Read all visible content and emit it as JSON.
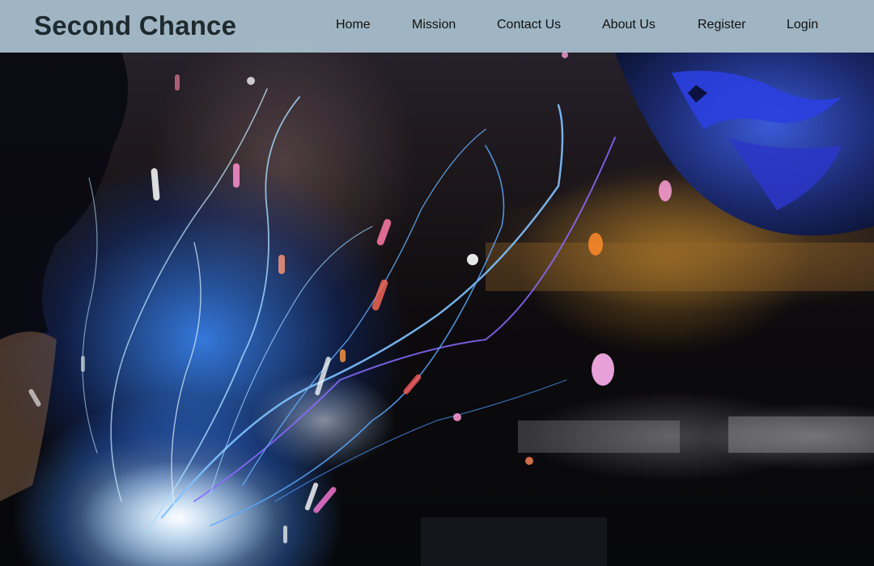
{
  "brand": {
    "name": "Second Chance"
  },
  "nav": {
    "items": [
      {
        "label": "Home"
      },
      {
        "label": "Mission"
      },
      {
        "label": "Contact Us"
      },
      {
        "label": "About Us"
      },
      {
        "label": "Register"
      },
      {
        "label": "Login"
      }
    ]
  },
  "hero": {
    "image_subject": "welding-sparks-photo"
  },
  "colors": {
    "navbar_background": "#bad6e4",
    "brand_text": "#1f2a2e",
    "nav_text": "#111111",
    "spark_blue": "#3c8cff"
  }
}
